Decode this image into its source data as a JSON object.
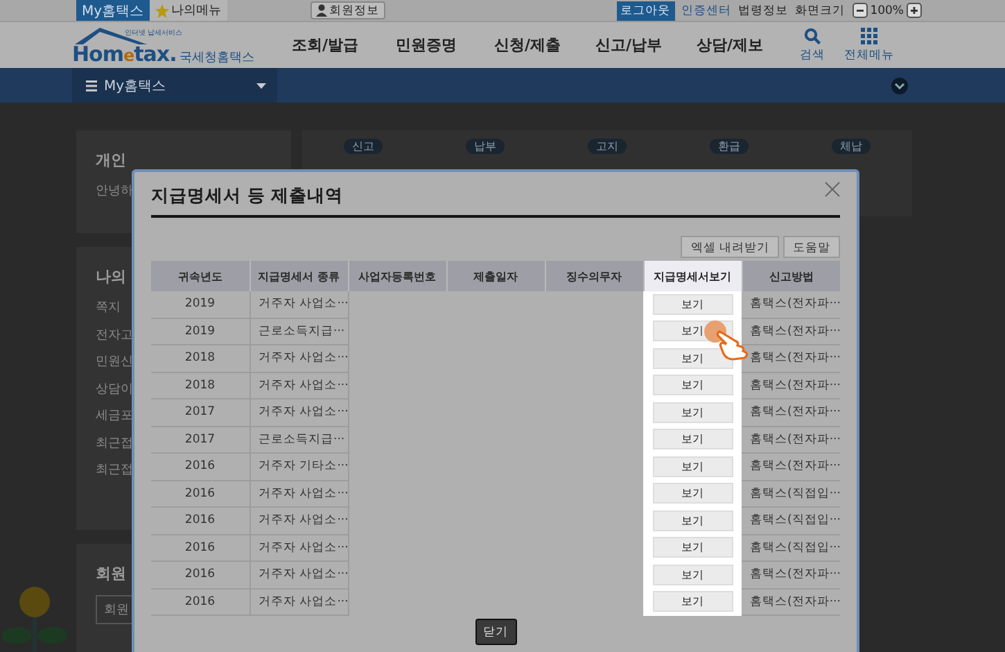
{
  "top_bar": {
    "tabs": [
      {
        "label": "My홈택스",
        "selected": true
      },
      {
        "label": "나의메뉴",
        "selected": false
      }
    ],
    "member": "회원정보",
    "links": [
      {
        "label": "로그아웃",
        "kind": "primary"
      },
      {
        "label": "인증센터",
        "kind": "link"
      },
      {
        "label": "법령정보",
        "kind": "plain"
      },
      {
        "label": "화면크기",
        "kind": "plain"
      }
    ],
    "zoom": "100%"
  },
  "header": {
    "logo": {
      "tagline": "인터넷 납세서비스",
      "name_start": "Hom",
      "name_mid": "e",
      "name_end": "tax.",
      "subtitle": "국세청홈택스"
    },
    "menu": [
      "조회/발급",
      "민원증명",
      "신청/제출",
      "신고/납부",
      "상담/제보"
    ],
    "tools": [
      {
        "label": "검색",
        "kind": "search"
      },
      {
        "label": "전체메뉴",
        "kind": "grid"
      }
    ]
  },
  "sub_nav": {
    "title": "My홈택스"
  },
  "background": {
    "left_panels": [
      {
        "title": "개인",
        "lines": [
          "안녕하"
        ]
      },
      {
        "title": "나의",
        "lines": [
          "쪽지",
          "전자고",
          "민원신",
          "상담이",
          "세금포",
          "최근접",
          "최근접"
        ]
      },
      {
        "title": "회원",
        "lines": [
          "회원"
        ]
      }
    ],
    "badges": [
      "신고",
      "납부",
      "고지",
      "환급",
      "체납"
    ]
  },
  "dialog": {
    "title": "지급명세서 등 제출내역",
    "buttons": [
      "엑셀 내려받기",
      "도움말"
    ],
    "table": {
      "columns": [
        "귀속년도",
        "지급명세서 종류",
        "사업자등록번호",
        "제출일자",
        "징수의무자",
        "지급명세서보기",
        "신고방법"
      ],
      "rows": [
        {
          "year": "2019",
          "type": "거주자 사업소···",
          "view": "보기",
          "method": "홈택스(전자파···"
        },
        {
          "year": "2019",
          "type": "근로소득지급···",
          "view": "보기",
          "method": "홈택스(전자파···"
        },
        {
          "year": "2018",
          "type": "거주자 사업소···",
          "view": "보기",
          "method": "홈택스(전자파···"
        },
        {
          "year": "2018",
          "type": "거주자 사업소···",
          "view": "보기",
          "method": "홈택스(전자파···"
        },
        {
          "year": "2017",
          "type": "거주자 사업소···",
          "view": "보기",
          "method": "홈택스(전자파···"
        },
        {
          "year": "2017",
          "type": "근로소득지급···",
          "view": "보기",
          "method": "홈택스(전자파···"
        },
        {
          "year": "2016",
          "type": "거주자 기타소···",
          "view": "보기",
          "method": "홈택스(전자파···"
        },
        {
          "year": "2016",
          "type": "거주자 사업소···",
          "view": "보기",
          "method": "홈택스(직접입···"
        },
        {
          "year": "2016",
          "type": "거주자 사업소···",
          "view": "보기",
          "method": "홈택스(직접입···"
        },
        {
          "year": "2016",
          "type": "거주자 사업소···",
          "view": "보기",
          "method": "홈택스(직접입···"
        },
        {
          "year": "2016",
          "type": "거주자 사업소···",
          "view": "보기",
          "method": "홈택스(전자파···"
        },
        {
          "year": "2016",
          "type": "거주자 사업소···",
          "view": "보기",
          "method": "홈택스(전자파···"
        }
      ]
    },
    "close_button": "닫기"
  }
}
